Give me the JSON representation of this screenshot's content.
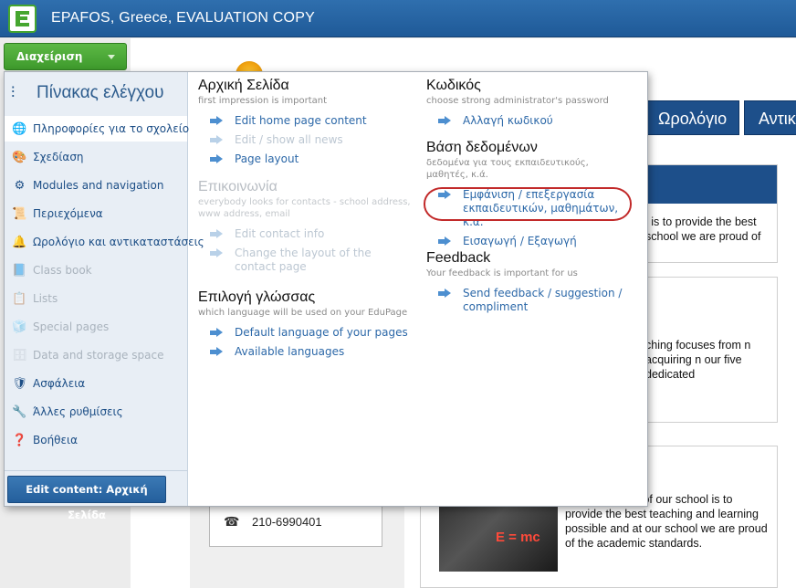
{
  "window": {
    "title": "EPAFOS, Greece, EVALUATION COPY"
  },
  "admin_button": {
    "label": "Διαχείριση"
  },
  "background": {
    "tabs": [
      "Ωρολόγιο",
      "Αντικ"
    ],
    "box1_text": "l is to provide the best school we are proud of",
    "box2_text": "ching focuses from n acquiring n our five dedicated",
    "box3_text": "rimary function of our school is to provide the best teaching and learning possible and at our school we are proud of the academic standards.",
    "phone": "210-6990401",
    "image_mark": "E = mc"
  },
  "sidebar": {
    "title": "Πίνακας ελέγχου",
    "items": [
      {
        "label": "Πληροφορίες για το σχολείο",
        "icon": "globe-icon",
        "glyph": "🌐",
        "active": true,
        "disabled": false
      },
      {
        "label": "Σχεδίαση",
        "icon": "palette-icon",
        "glyph": "🎨",
        "active": false,
        "disabled": false
      },
      {
        "label": "Modules and navigation",
        "icon": "modules-icon",
        "glyph": "⚙",
        "active": false,
        "disabled": false
      },
      {
        "label": "Περιεχόμενα",
        "icon": "content-icon",
        "glyph": "📜",
        "active": false,
        "disabled": false
      },
      {
        "label": "Ωρολόγιο και αντικαταστάσεις",
        "icon": "bell-icon",
        "glyph": "🔔",
        "active": false,
        "disabled": false
      },
      {
        "label": "Class book",
        "icon": "book-icon",
        "glyph": "📘",
        "active": false,
        "disabled": true
      },
      {
        "label": "Lists",
        "icon": "list-icon",
        "glyph": "📋",
        "active": false,
        "disabled": true
      },
      {
        "label": "Special pages",
        "icon": "cube-icon",
        "glyph": "🧊",
        "active": false,
        "disabled": true
      },
      {
        "label": "Data and storage space",
        "icon": "storage-icon",
        "glyph": "🗄",
        "active": false,
        "disabled": true
      },
      {
        "label": "Ασφάλεια",
        "icon": "shield-icon",
        "glyph": "🛡",
        "active": false,
        "disabled": false
      },
      {
        "label": "Άλλες ρυθμίσεις",
        "icon": "tools-icon",
        "glyph": "🔧",
        "active": false,
        "disabled": false
      },
      {
        "label": "Βοήθεια",
        "icon": "help-icon",
        "glyph": "❓",
        "active": false,
        "disabled": false
      }
    ],
    "edit_button": "Edit content: Αρχική Σελίδα"
  },
  "sections": {
    "home": {
      "title": "Αρχική Σελίδα",
      "subtitle": "first impression is important",
      "links": [
        "Edit home page content",
        "Edit / show all news",
        "Page layout"
      ]
    },
    "contact": {
      "title": "Επικοινωνία",
      "subtitle": "everybody looks for contacts - school address, www address, email",
      "links": [
        "Edit contact info",
        "Change the layout of the contact page"
      ]
    },
    "language": {
      "title": "Επιλογή γλώσσας",
      "subtitle": "which language will be used on your EduPage",
      "links": [
        "Default language of your pages",
        "Available languages"
      ]
    },
    "password": {
      "title": "Κωδικός",
      "subtitle": "choose strong administrator's password",
      "links": [
        "Αλλαγή κωδικού"
      ]
    },
    "database": {
      "title": "Βάση δεδομένων",
      "subtitle": "δεδομένα για τους εκπαιδευτικούς, μαθητές, κ.ά.",
      "links": [
        "Εμφάνιση / επεξεργασία εκπαιδευτικών, μαθημάτων, κ.α.",
        "Εισαγωγή / Εξαγωγή"
      ]
    },
    "feedback": {
      "title": "Feedback",
      "subtitle": "Your feedback is important for us",
      "links": [
        "Send feedback / suggestion / compliment"
      ]
    }
  },
  "colors": {
    "accent": "#1f5a98",
    "admin_green": "#45a62f",
    "highlight_circle": "#c22a2a",
    "link": "#2c68a8"
  }
}
